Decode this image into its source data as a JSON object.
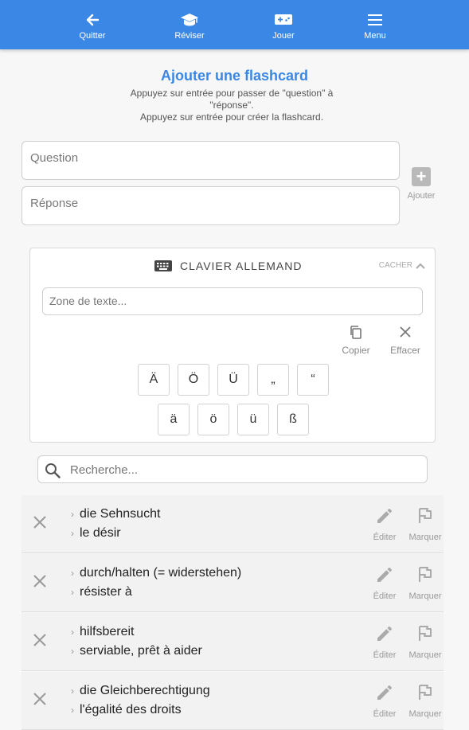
{
  "nav": {
    "items": [
      {
        "label": "Quitter",
        "icon": "arrow-left-icon"
      },
      {
        "label": "Réviser",
        "icon": "graduation-cap-icon"
      },
      {
        "label": "Jouer",
        "icon": "gamepad-icon"
      },
      {
        "label": "Menu",
        "icon": "hamburger-menu-icon"
      }
    ]
  },
  "form": {
    "title": "Ajouter une flashcard",
    "help_line1": "Appuyez sur entrée pour passer de \"question\" à \"réponse\".",
    "help_line2": "Appuyez sur entrée pour créer la flashcard.",
    "question_placeholder": "Question",
    "answer_placeholder": "Réponse",
    "add_label": "Ajouter"
  },
  "keyboard": {
    "title": "CLAVIER ALLEMAND",
    "hide_label": "CACHER",
    "text_placeholder": "Zone de texte...",
    "copy_label": "Copier",
    "clear_label": "Effacer",
    "row1": [
      "Ä",
      "Ö",
      "Ü",
      "„",
      "“"
    ],
    "row2": [
      "ä",
      "ö",
      "ü",
      "ß"
    ]
  },
  "search": {
    "placeholder": "Recherche..."
  },
  "cards": [
    {
      "question": "die Sehnsucht",
      "answer": "le désir",
      "edit_label": "Éditer",
      "flag_label": "Marquer"
    },
    {
      "question": "durch/halten (= widerstehen)",
      "answer": "résister à",
      "edit_label": "Éditer",
      "flag_label": "Marquer"
    },
    {
      "question": "hilfsbereit",
      "answer": "serviable, prêt à aider",
      "edit_label": "Éditer",
      "flag_label": "Marquer"
    },
    {
      "question": "die Gleichberechtigung",
      "answer": "l'égalité des droits",
      "edit_label": "Éditer",
      "flag_label": "Marquer"
    }
  ],
  "colors": {
    "accent": "#3b87e6",
    "background": "#f7f7f7",
    "card": "#f2f2f2"
  }
}
